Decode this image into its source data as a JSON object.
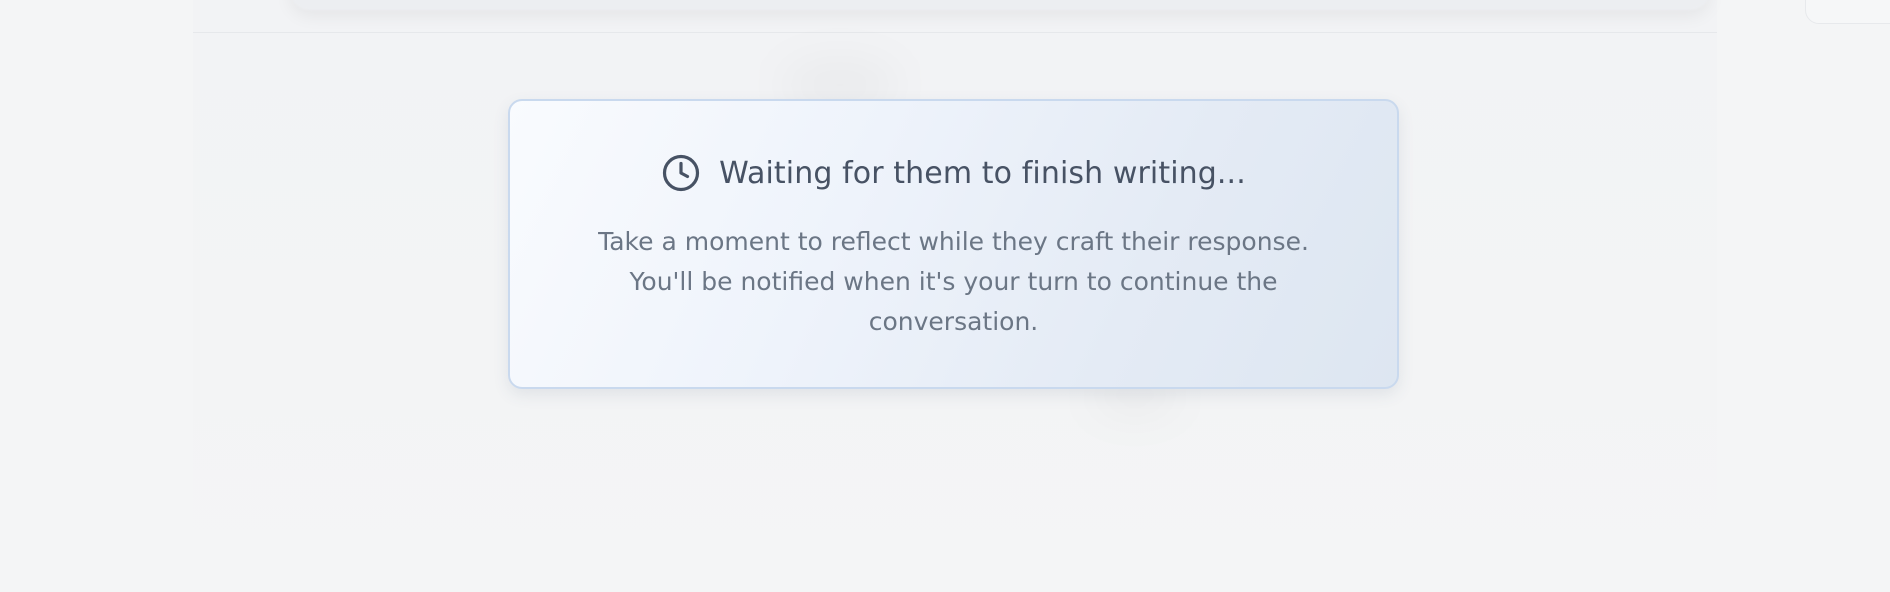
{
  "waiting_card": {
    "icon": "clock-icon",
    "title": "Waiting for them to finish writing...",
    "message": "Take a moment to reflect while they craft their response. You'll be notified when it's your turn to continue the conversation."
  },
  "colors": {
    "background": "#f4f5f6",
    "card_border": "#c9d9ee",
    "title_text": "#475264",
    "body_text": "#6b7685"
  }
}
